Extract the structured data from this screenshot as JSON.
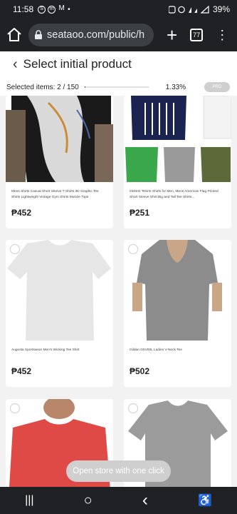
{
  "status_bar": {
    "time": "11:58",
    "icons": [
      "S",
      "m",
      "M"
    ],
    "dot": "•",
    "battery": "39%"
  },
  "browser": {
    "url": "seataoo.com/public/h",
    "tabs_count": "77"
  },
  "header": {
    "title": "Select initial product",
    "selected_label": "Selected items: 2 / 150",
    "percent": "1.33%",
    "progress_fraction": 0.0133,
    "pill_label": "PRD"
  },
  "products": [
    {
      "name": "Mens Shirts Casual Short Sleeve T-Shirts 3D Graphic Tee Shirts Lightweight Vintage Gym Shirts Muscle Tops",
      "price": "₱452"
    },
    {
      "name": "GENIG Tshirts Shirts for Men, Mens American Flag Printed Short Sleeve Shirt Big and Tall Tee Shirts...",
      "price": "₱251"
    },
    {
      "name": "Augusta Sportswear Men's Wicking Tee Shirt",
      "price": "₱452"
    },
    {
      "name": "Gildan G5V00L Ladies V-Neck Tee",
      "price": "₱502"
    },
    {
      "name": "",
      "price": ""
    },
    {
      "name": "",
      "price": ""
    }
  ],
  "footer": {
    "open_store_label": "Open store with one click"
  },
  "nav": {
    "recents": "|||",
    "home": "○",
    "back": "‹",
    "accessibility": "♿"
  }
}
